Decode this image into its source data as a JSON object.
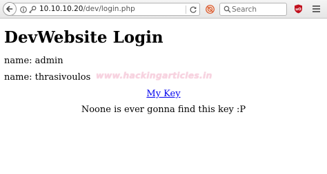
{
  "toolbar": {
    "url_host": "10.10.10.20",
    "url_path": "/dev/login.php",
    "search_placeholder": "Search",
    "icons": [
      "back-icon",
      "info-icon",
      "key-icon",
      "reload-icon",
      "extension-icon",
      "search-icon",
      "ublock-icon",
      "menu-icon"
    ]
  },
  "page": {
    "heading": "DevWebsite Login",
    "name_line_1": "name: admin",
    "name_line_2": "name: thrasivoulos",
    "link_text": "My Key",
    "message": "Noone is ever gonna find this key :P"
  },
  "watermark": "www.hackingarticles.in",
  "colors": {
    "link": "#0000ee",
    "watermark": "#f7d3e0",
    "ublock": "#c1121f"
  }
}
